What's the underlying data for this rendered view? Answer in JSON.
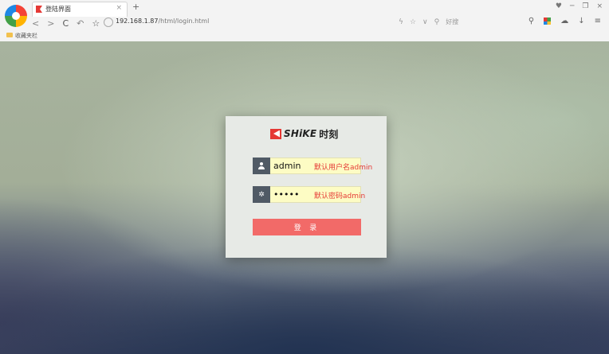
{
  "browser": {
    "tab_title": "登陆界面",
    "tab_close": "×",
    "new_tab": "+",
    "nav_back": "<",
    "nav_forward": ">",
    "nav_reload": "C",
    "nav_undo": "↶",
    "nav_star": "☆",
    "address_host": "192.168.1.87",
    "address_path": "/html/login.html",
    "search_placeholder": "好搜",
    "bookmark_label": "收藏夹栏",
    "window_controls": [
      "♥",
      "─",
      "❐",
      "×"
    ]
  },
  "login": {
    "brand_name": "SHiKE",
    "brand_cn": "时刻",
    "username_value": "admin",
    "username_hint": "默认用户名admin",
    "password_value": "admin",
    "password_hint": "默认密码admin",
    "login_button": "登 录"
  },
  "colors": {
    "brand_red": "#e53935",
    "button": "#f26a68",
    "field_bg": "#fdfcc4",
    "icon_bg": "#505a65"
  }
}
